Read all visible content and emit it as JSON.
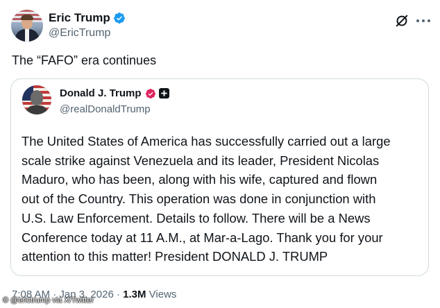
{
  "author": {
    "name": "Eric Trump",
    "handle": "@EricTrump"
  },
  "tweet": {
    "text": "The “FAFO” era continues"
  },
  "quoted": {
    "name": "Donald J. Trump",
    "handle": "@realDonaldTrump",
    "lines": [
      "The United States of America has successfully carried out a large",
      "scale strike against Venezuela and its leader, President Nicolas",
      "Maduro, who has been, along with his wife, captured and flown",
      "out of the Country. This operation was done in conjunction with",
      "U.S. Law Enforcement. Details to follow. There will be a News",
      "Conference today at 11 A.M., at Mar-a-Lago. Thank you for your",
      "attention to this matter! President DONALD J. TRUMP"
    ]
  },
  "meta": {
    "time": "7:08 AM",
    "sep1": "·",
    "date": "Jan 3, 2026",
    "sep2": "·",
    "views_count": "1.3M",
    "views_label": "Views"
  },
  "credit": "© @erictrump via X/Twitter",
  "icons": {
    "verified_main": "verified-badge-icon",
    "verified_quote": "verified-badge-icon",
    "affiliation": "affiliation-badge-icon",
    "grok": "grok-icon",
    "more": "more-icon"
  },
  "colors": {
    "verified_blue": "#1d9bf0",
    "verified_pink": "#e0245e",
    "text_secondary": "#536471"
  }
}
